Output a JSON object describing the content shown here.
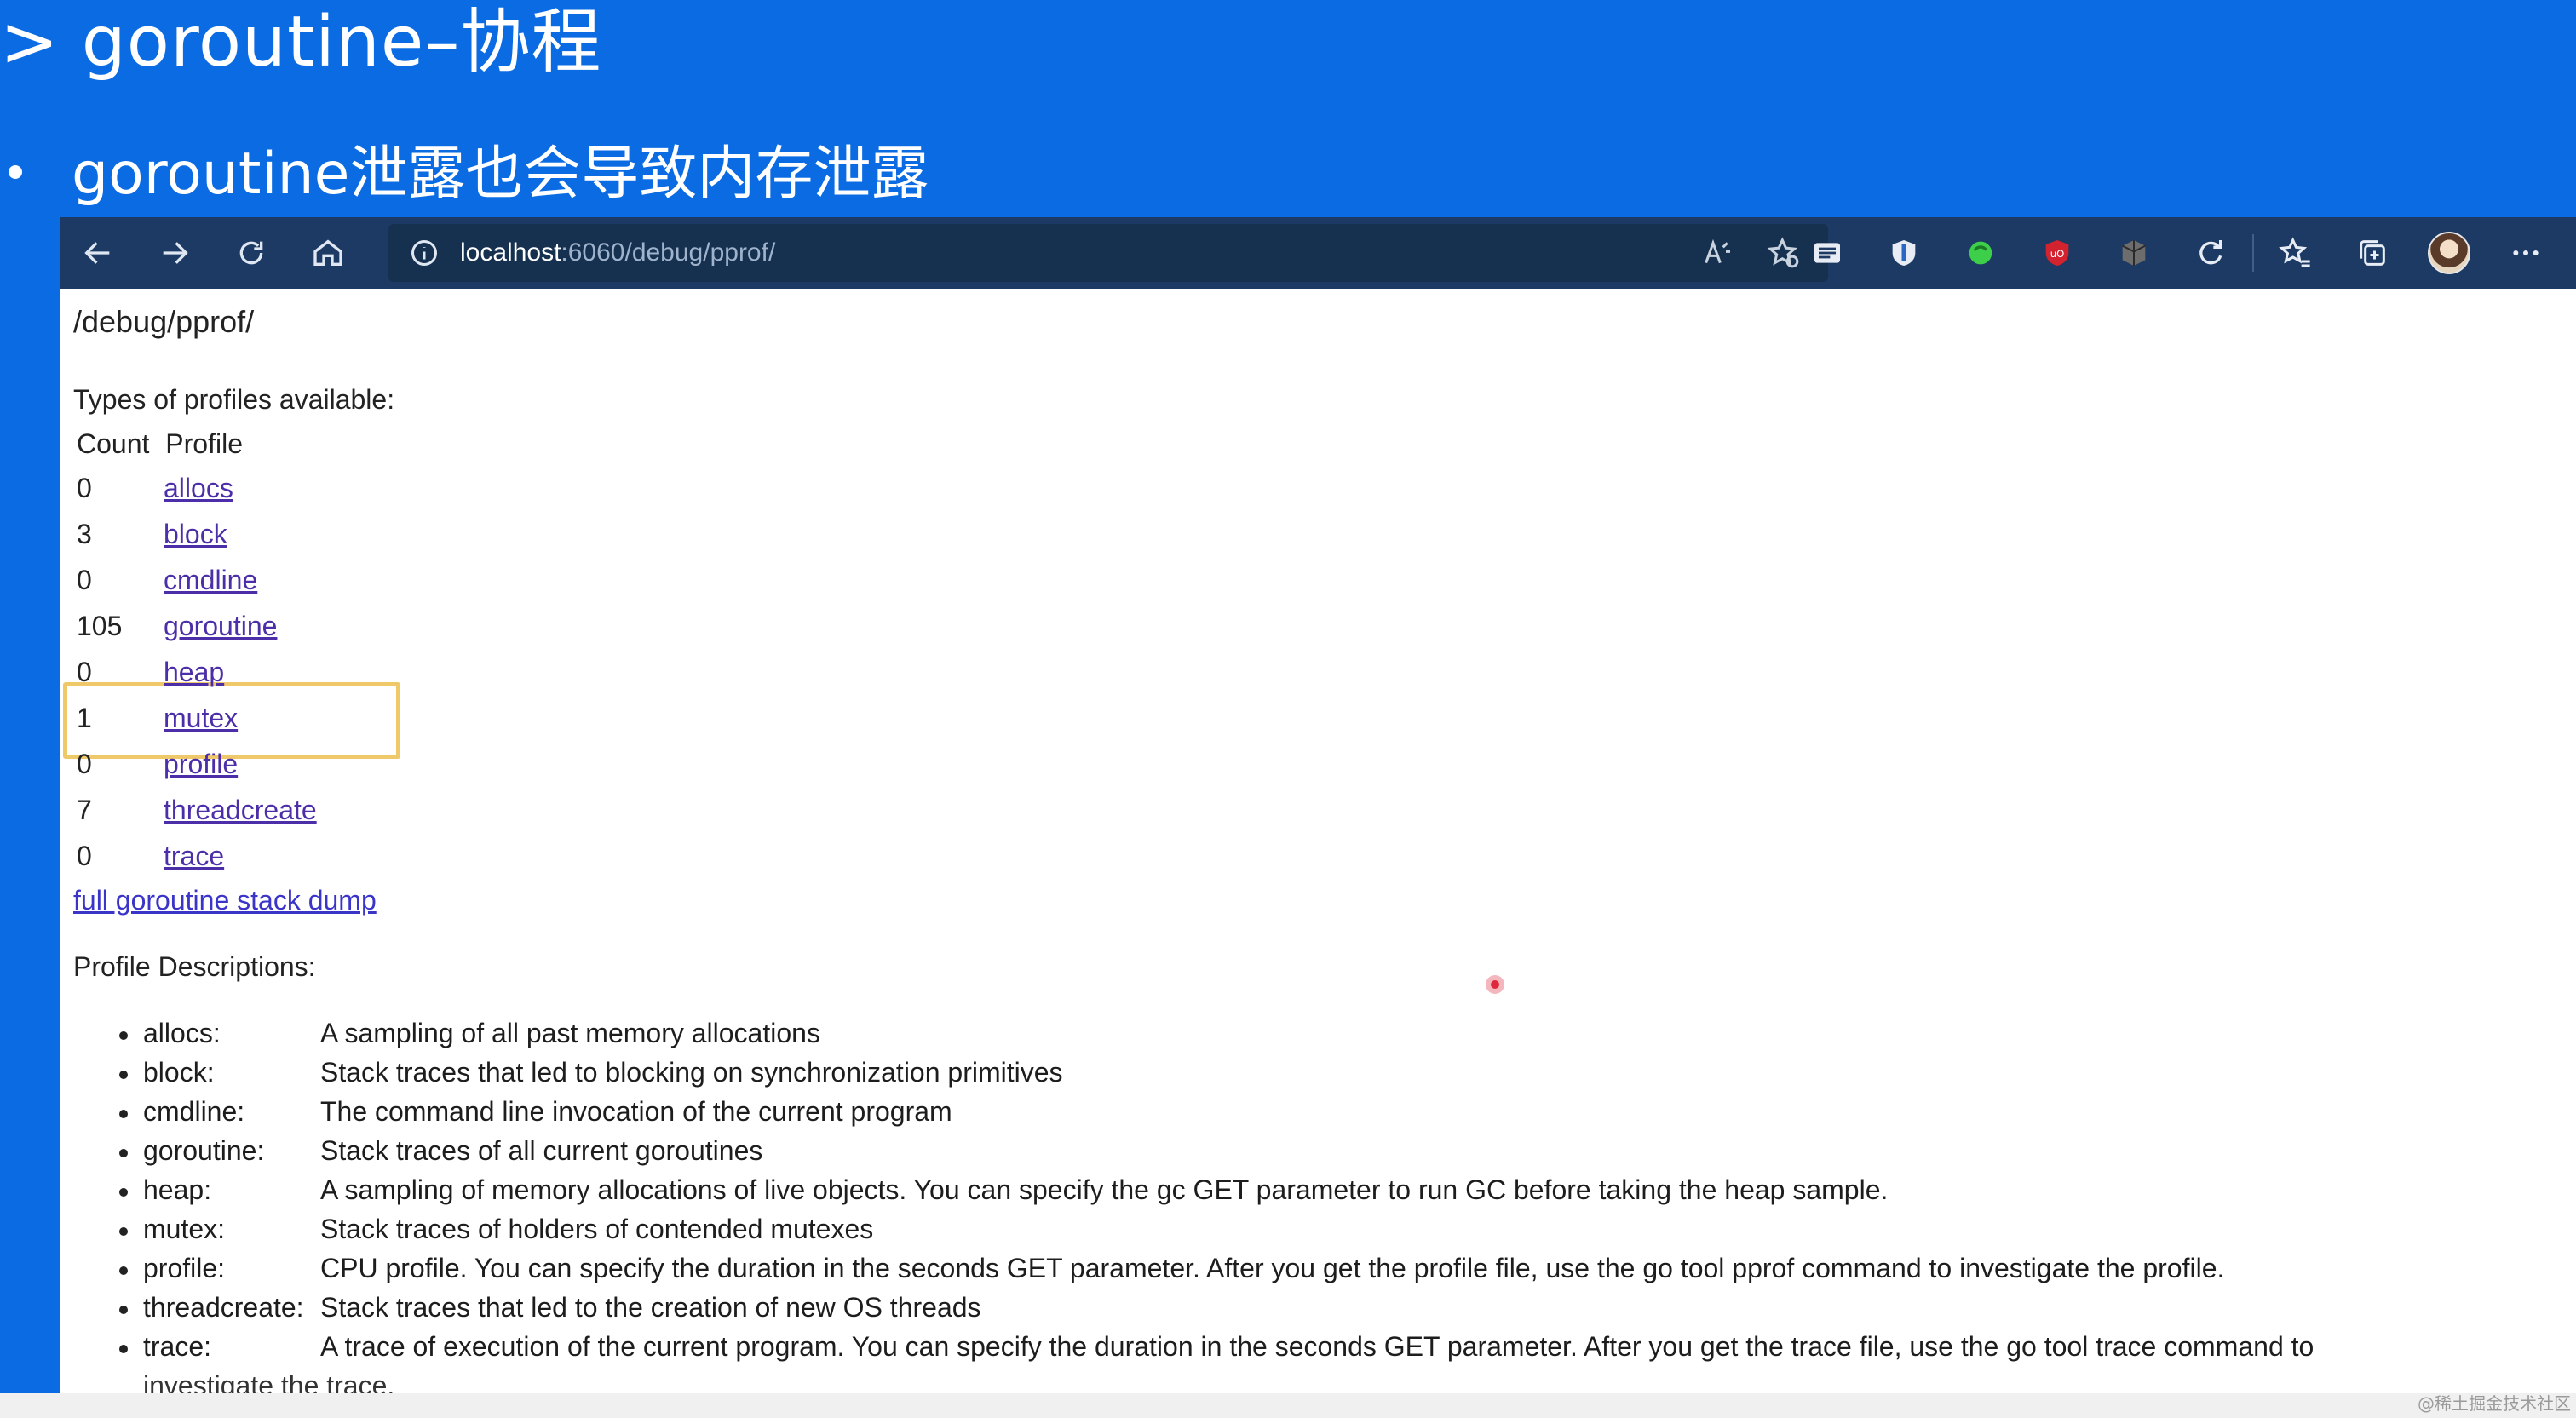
{
  "slide": {
    "title_prefix": ">",
    "title": "goroutine–协程",
    "bullet": "goroutine泄露也会导致内存泄露"
  },
  "browser": {
    "url_host": "localhost",
    "url_rest": ":6060/debug/pprof/",
    "toolbar_icons": [
      "back-icon",
      "forward-icon",
      "refresh-icon",
      "home-icon",
      "info-icon",
      "read-aloud-icon",
      "add-favorite-icon",
      "extension-icons",
      "favorites-icon",
      "collections-icon",
      "profile-avatar",
      "more-icon"
    ]
  },
  "page": {
    "heading": "/debug/pprof/",
    "types_label": "Types of profiles available:",
    "col_count": "Count",
    "col_profile": "Profile",
    "profiles": [
      {
        "count": "0",
        "name": "allocs"
      },
      {
        "count": "3",
        "name": "block"
      },
      {
        "count": "0",
        "name": "cmdline"
      },
      {
        "count": "105",
        "name": "goroutine"
      },
      {
        "count": "0",
        "name": "heap"
      },
      {
        "count": "1",
        "name": "mutex"
      },
      {
        "count": "0",
        "name": "profile"
      },
      {
        "count": "7",
        "name": "threadcreate"
      },
      {
        "count": "0",
        "name": "trace"
      }
    ],
    "full_dump": "full goroutine stack dump",
    "desc_title": "Profile Descriptions:",
    "descriptions": [
      {
        "name": "allocs:",
        "text": "A sampling of all past memory allocations"
      },
      {
        "name": "block:",
        "text": "Stack traces that led to blocking on synchronization primitives"
      },
      {
        "name": "cmdline:",
        "text": "The command line invocation of the current program"
      },
      {
        "name": "goroutine:",
        "text": "Stack traces of all current goroutines"
      },
      {
        "name": "heap:",
        "text": "A sampling of memory allocations of live objects. You can specify the gc GET parameter to run GC before taking the heap sample."
      },
      {
        "name": "mutex:",
        "text": "Stack traces of holders of contended mutexes"
      },
      {
        "name": "profile:",
        "text": "CPU profile. You can specify the duration in the seconds GET parameter. After you get the profile file, use the go tool pprof command to investigate the profile."
      },
      {
        "name": "threadcreate:",
        "text": "Stack traces that led to the creation of new OS threads"
      },
      {
        "name": "trace:",
        "text": "A trace of execution of the current program. You can specify the duration in the seconds GET parameter. After you get the trace file, use the go tool trace command to",
        "continuation": "investigate the trace."
      }
    ]
  },
  "colors": {
    "slide_bg": "#0a6be3",
    "toolbar_bg": "#1c3a63",
    "link": "#4b2ea8",
    "highlight_box": "#efc86a"
  },
  "watermark": "@稀土掘金技术社区"
}
